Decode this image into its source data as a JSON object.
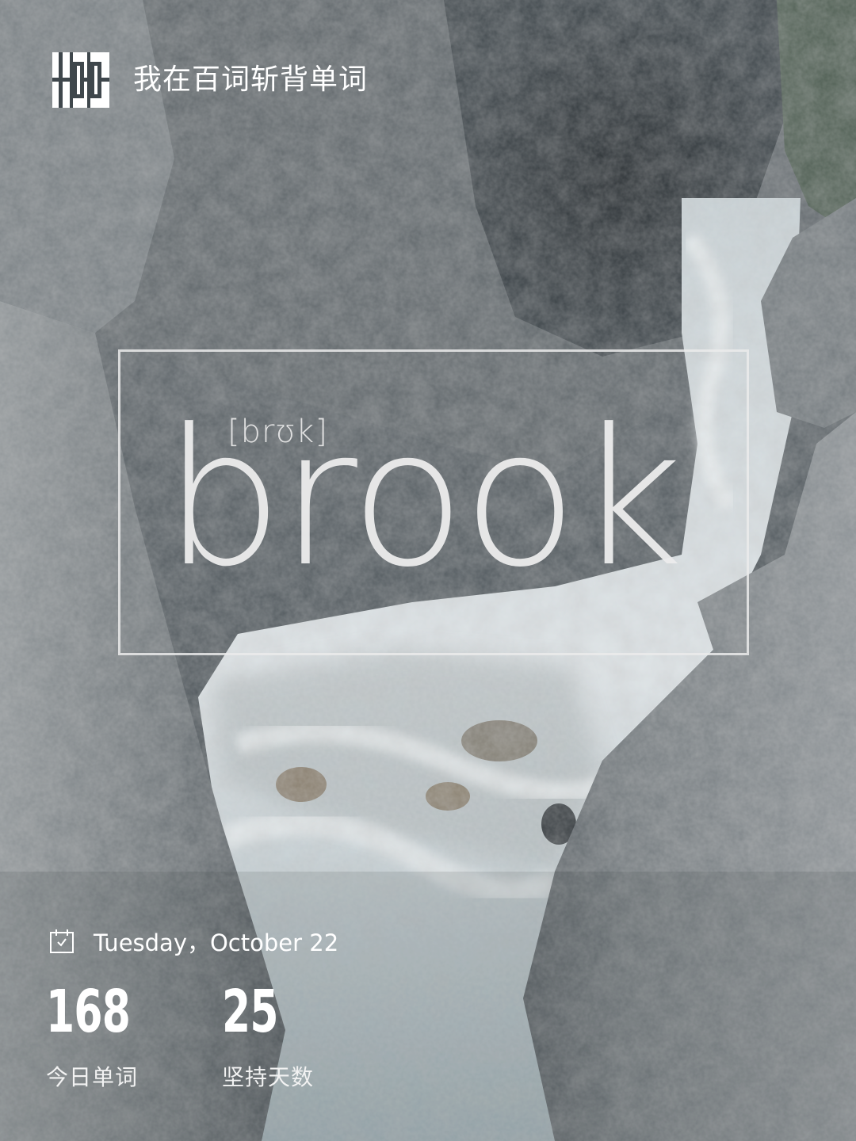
{
  "header": {
    "logo_icon": "baicizhan-100-logo-icon",
    "slogan": "我在百词斩背单词"
  },
  "card": {
    "phonetic": "[brʊk]",
    "word": "brook"
  },
  "footer": {
    "calendar_icon": "calendar-check-icon",
    "date": "Tuesday，October 22",
    "stats": [
      {
        "value": "168",
        "label": "今日单词"
      },
      {
        "value": "25",
        "label": "坚持天数"
      }
    ]
  },
  "colors": {
    "text": "#ffffff",
    "frame": "#ebebeb",
    "rock_dark": "#2f363c",
    "rock_light": "#9aa0a3",
    "water": "#d8dde0"
  }
}
